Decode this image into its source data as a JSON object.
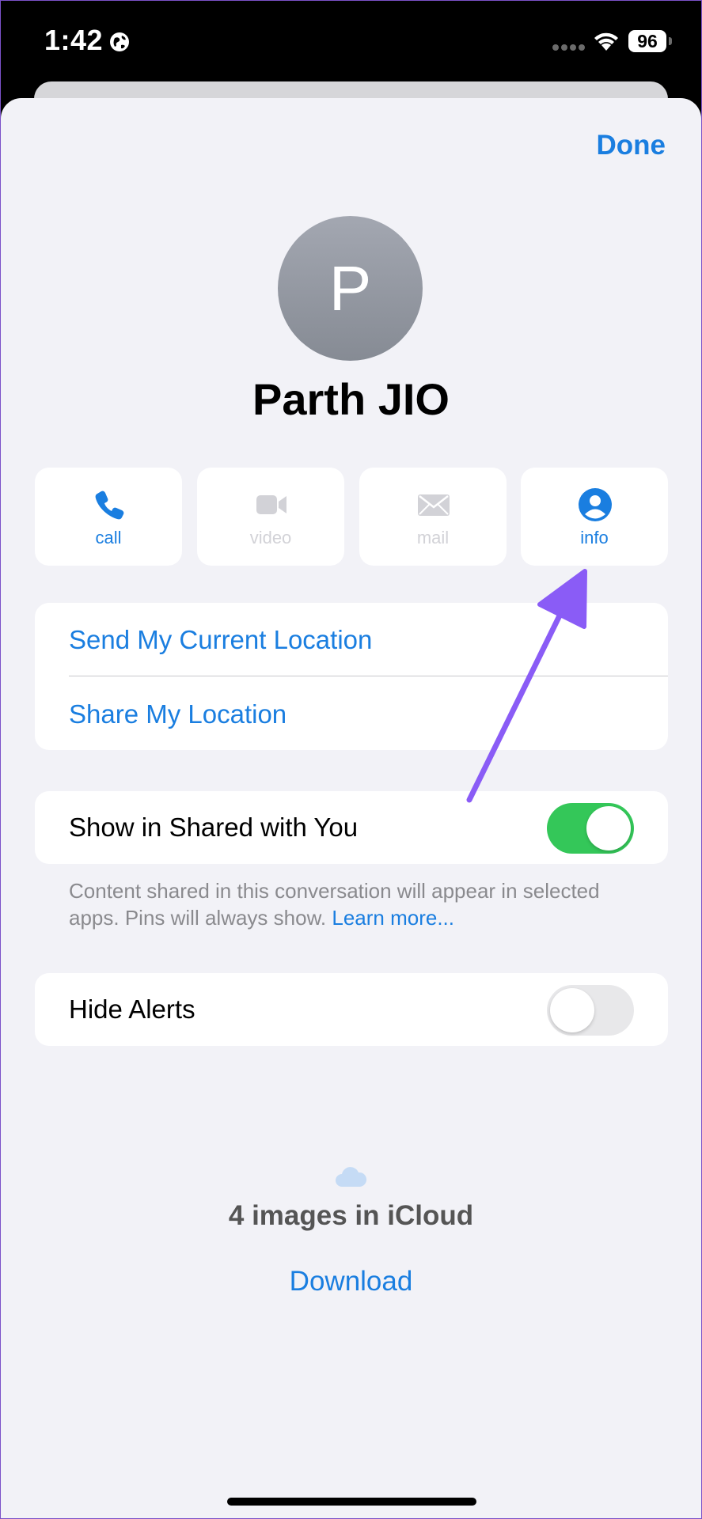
{
  "status_bar": {
    "time": "1:42",
    "battery": "96"
  },
  "header": {
    "done_label": "Done"
  },
  "contact": {
    "initial": "P",
    "name": "Parth JIO"
  },
  "actions": [
    {
      "label": "call",
      "icon": "phone-icon",
      "enabled": true
    },
    {
      "label": "video",
      "icon": "video-icon",
      "enabled": false
    },
    {
      "label": "mail",
      "icon": "mail-icon",
      "enabled": false
    },
    {
      "label": "info",
      "icon": "person-circle-icon",
      "enabled": true
    }
  ],
  "location": {
    "send_current": "Send My Current Location",
    "share": "Share My Location"
  },
  "shared_with_you": {
    "label": "Show in Shared with You",
    "toggle_on": true,
    "footnote": "Content shared in this conversation will appear in selected apps. Pins will always show.",
    "learn_more": "Learn more..."
  },
  "hide_alerts": {
    "label": "Hide Alerts",
    "toggle_on": false
  },
  "icloud": {
    "title": "4 images in iCloud",
    "download": "Download"
  },
  "colors": {
    "accent": "#1a7ee0",
    "toggle_on": "#34c759",
    "annotation_arrow": "#8a5cf6",
    "sheet_bg": "#f2f2f7"
  }
}
